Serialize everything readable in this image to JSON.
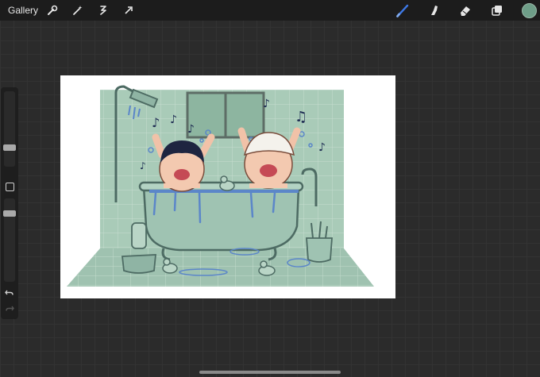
{
  "topbar": {
    "gallery_label": "Gallery",
    "left_tools": [
      "wrench-icon",
      "magic-wand-icon",
      "selection-icon",
      "transform-arrow-icon"
    ],
    "right_tools": [
      "brush-icon",
      "smudge-icon",
      "eraser-icon",
      "layers-icon"
    ],
    "brush_active_color": "#3d78e6",
    "current_color": "#6e9e88"
  },
  "sidebar": {
    "size_slider_level": 0.75,
    "opacity_slider_level": 0.9
  },
  "artwork": {
    "subject": "two children singing in a clawfoot bathtub",
    "tile_color": "#a9cbb8",
    "tub_color": "#9fc3b2",
    "water_color": "#5b86c9"
  }
}
